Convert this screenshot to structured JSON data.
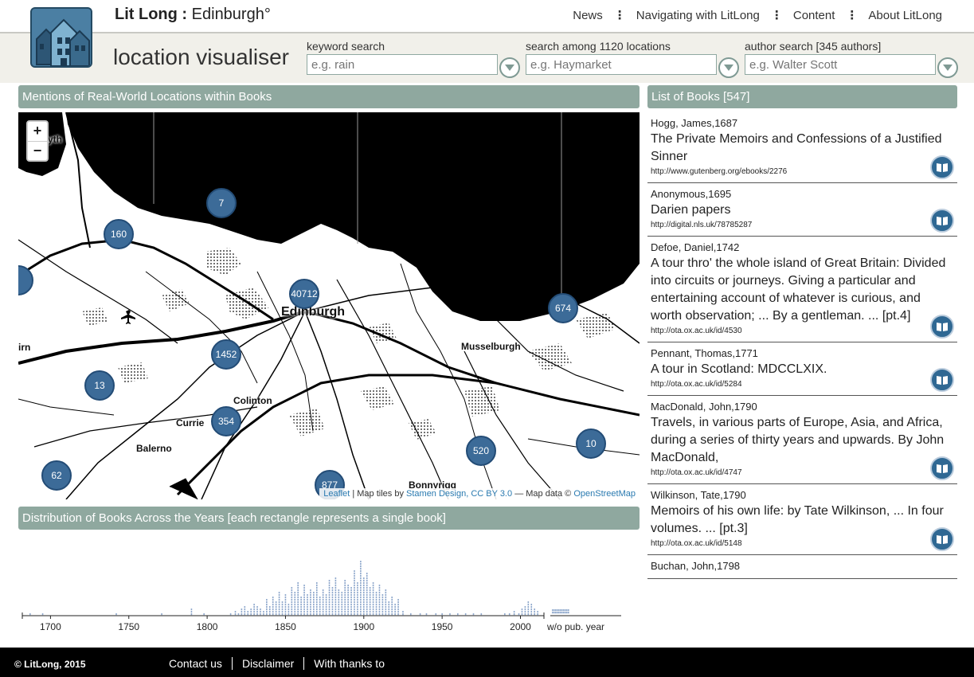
{
  "header": {
    "brand_bold": "Lit Long",
    "brand_sep": ":",
    "brand_city": "Edinburgh°",
    "nav": [
      "News",
      "Navigating with LitLong",
      "Content",
      "About LitLong"
    ],
    "subtitle": "location visualiser"
  },
  "search": {
    "keyword_label": "keyword search",
    "keyword_placeholder": "e.g. rain",
    "location_label": "search among 1120 locations",
    "location_placeholder": "e.g. Haymarket",
    "author_label": "author search [345 authors]",
    "author_placeholder": "e.g. Walter Scott"
  },
  "map": {
    "panel_title": "Mentions of Real-World Locations within Books",
    "zoom_in": "+",
    "zoom_out": "−",
    "clusters": [
      "7",
      "160",
      "40712",
      "674",
      "1452",
      "13",
      "354",
      "520",
      "10",
      "62",
      "877"
    ],
    "places": [
      "Edinburgh",
      "Musselburgh",
      "Colinton",
      "Currie",
      "Balerno",
      "Bonnyrigg",
      "yth",
      "irn"
    ],
    "attribution": {
      "leaflet": "Leaflet",
      "tiles": "| Map tiles by",
      "stamen": "Stamen Design,",
      "license": "CC BY 3.0",
      "data": "— Map data ©",
      "osm": "OpenStreetMap"
    }
  },
  "chart_data": {
    "type": "bar",
    "title": "Distribution of Books Across the Years [each rectangle represents a single book]",
    "x_ticks": [
      1700,
      1750,
      1800,
      1850,
      1900,
      1950,
      2000
    ],
    "extra_tick": "w/o pub. year",
    "xlim": [
      1682,
      2015
    ],
    "x": [
      1687,
      1695,
      1742,
      1771,
      1790,
      1798,
      1815,
      1818,
      1820,
      1822,
      1824,
      1826,
      1828,
      1830,
      1832,
      1834,
      1836,
      1838,
      1840,
      1842,
      1844,
      1846,
      1848,
      1850,
      1852,
      1854,
      1856,
      1858,
      1860,
      1862,
      1864,
      1866,
      1868,
      1870,
      1872,
      1874,
      1876,
      1878,
      1880,
      1882,
      1884,
      1886,
      1888,
      1890,
      1892,
      1894,
      1896,
      1898,
      1900,
      1902,
      1904,
      1906,
      1908,
      1910,
      1912,
      1914,
      1916,
      1918,
      1920,
      1922,
      1925,
      1930,
      1936,
      1940,
      1946,
      1950,
      1955,
      1960,
      1965,
      1970,
      1975,
      1990,
      1993,
      1996,
      1999,
      2001,
      2003,
      2005,
      2007,
      2009,
      2011
    ],
    "y": [
      1,
      1,
      1,
      1,
      3,
      1,
      1,
      2,
      1,
      3,
      4,
      2,
      3,
      5,
      4,
      3,
      2,
      7,
      4,
      8,
      6,
      10,
      6,
      9,
      5,
      12,
      10,
      14,
      8,
      13,
      9,
      11,
      10,
      14,
      8,
      11,
      9,
      15,
      12,
      16,
      11,
      10,
      15,
      13,
      12,
      19,
      14,
      23,
      16,
      18,
      12,
      14,
      10,
      13,
      9,
      11,
      6,
      8,
      5,
      7,
      2,
      1,
      1,
      1,
      1,
      1,
      1,
      1,
      1,
      1,
      1,
      1,
      1,
      2,
      1,
      3,
      4,
      6,
      5,
      3,
      2
    ],
    "no_year_count": 22
  },
  "books": {
    "panel_title": "List of Books [547]",
    "items": [
      {
        "author": "Hogg, James,1687",
        "title": "The Private Memoirs and Confessions of a Justified Sinner",
        "url": "http://www.gutenberg.org/ebooks/2276"
      },
      {
        "author": "Anonymous,1695",
        "title": "Darien papers",
        "url": "http://digital.nls.uk/78785287"
      },
      {
        "author": "Defoe, Daniel,1742",
        "title": "A tour thro' the whole island of Great Britain: Divided into circuits or journeys. Giving a particular and entertaining account of whatever is curious, and worth observation; ... By a gentleman. ... [pt.4]",
        "url": "http://ota.ox.ac.uk/id/4530"
      },
      {
        "author": "Pennant, Thomas,1771",
        "title": "A tour in Scotland: MDCCLXIX.",
        "url": "http://ota.ox.ac.uk/id/5284"
      },
      {
        "author": "MacDonald, John,1790",
        "title": "Travels, in various parts of Europe, Asia, and Africa, during a series of thirty years and upwards. By John MacDonald,",
        "url": "http://ota.ox.ac.uk/id/4747"
      },
      {
        "author": "Wilkinson, Tate,1790",
        "title": "Memoirs of his own life: by Tate Wilkinson, ... In four volumes. ... [pt.3]",
        "url": "http://ota.ox.ac.uk/id/5148"
      },
      {
        "author": "Buchan, John,1798",
        "title": "",
        "url": ""
      }
    ]
  },
  "footer": {
    "copyright": "© LitLong, 2015",
    "links": [
      "Contact us",
      "Disclaimer",
      "With thanks to"
    ]
  },
  "colors": {
    "accent": "#8fa89f",
    "cluster": "#3c6b98",
    "bars": "#8fa8cc",
    "footer": "#000000"
  }
}
